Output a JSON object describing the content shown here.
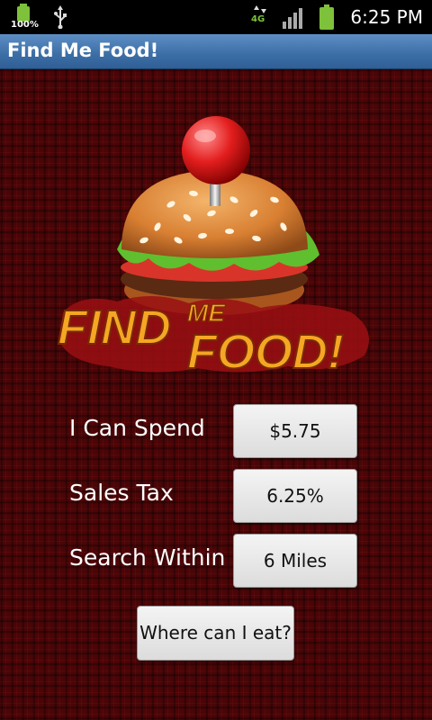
{
  "status_bar": {
    "battery_left_percent": "100%",
    "network_label": "4G",
    "time": "6:25 PM",
    "icons": [
      "battery-icon",
      "usb-icon",
      "4g-data-icon",
      "signal-icon",
      "battery-icon"
    ]
  },
  "title_bar": {
    "title": "Find Me Food!"
  },
  "logo": {
    "line1_word1": "FIND",
    "line1_word2": "ME",
    "line2_word": "FOOD!"
  },
  "form": {
    "spend_label": "I Can Spend",
    "spend_value": "$5.75",
    "tax_label": "Sales Tax",
    "tax_value": "6.25%",
    "distance_label": "Search Within",
    "distance_value": "6 Miles",
    "submit_label": "Where can I eat?"
  },
  "colors": {
    "background": "#4a0507",
    "title_bar": "#3c6ea6",
    "logo_text": "#f5a623"
  }
}
